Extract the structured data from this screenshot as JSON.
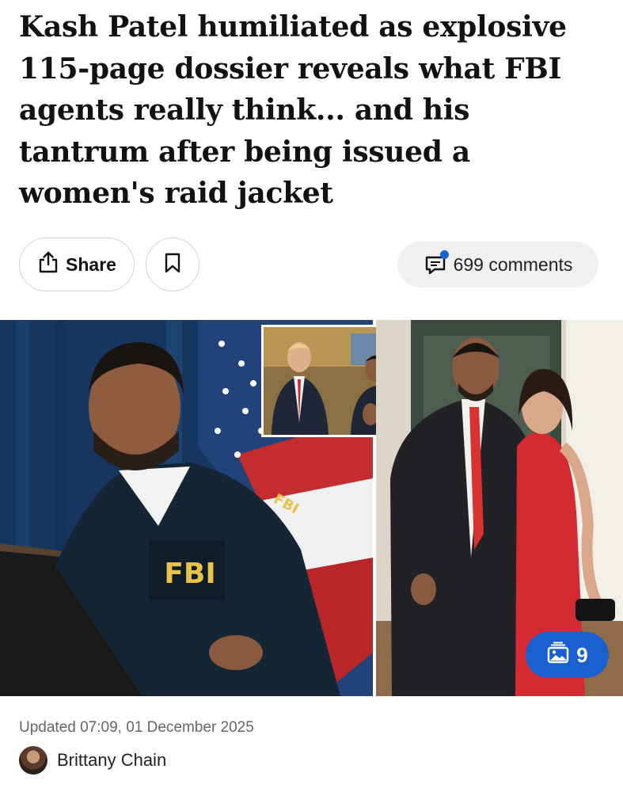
{
  "article": {
    "headline": "Kash Patel humiliated as explosive 115-page dossier reveals what FBI agents really think... and his tantrum after being issued a women's raid jacket",
    "updated": "Updated 07:09, 01 December 2025",
    "author": "Brittany Chain"
  },
  "actions": {
    "share_label": "Share",
    "comments_label": "699 comments"
  },
  "media": {
    "gallery_count": "9",
    "left_image_text": "FBI",
    "left_image_sleeve_text": "FBI"
  },
  "colors": {
    "accent": "#1a5fcf",
    "headline": "#121212",
    "meta": "#666666"
  },
  "icons": [
    "share-icon",
    "bookmark-icon",
    "comment-icon",
    "gallery-icon"
  ]
}
